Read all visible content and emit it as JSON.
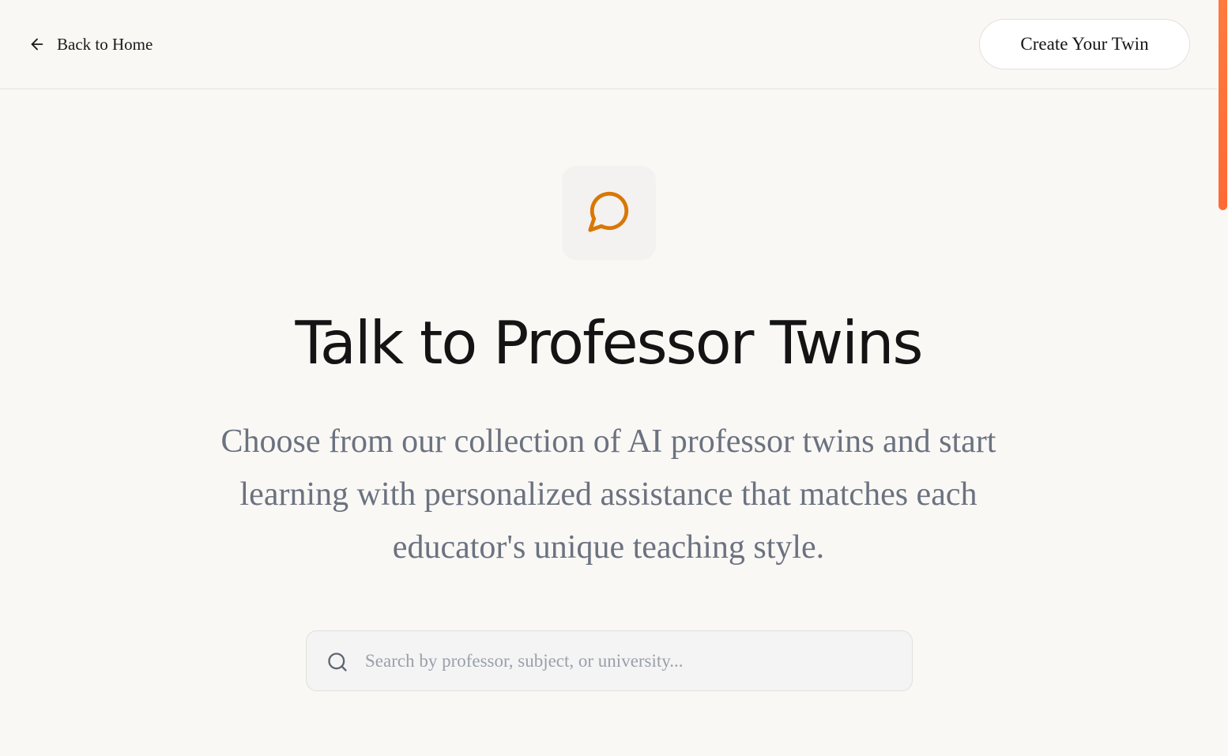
{
  "header": {
    "back_label": "Back to Home",
    "back_icon": "arrow-left-icon",
    "cta_label": "Create Your Twin"
  },
  "hero": {
    "icon": "message-circle-icon",
    "title": "Talk to Professor Twins",
    "subtitle": "Choose from our collection of AI professor twins and start learning with personalized assistance that matches each educator's unique teaching style."
  },
  "search": {
    "icon": "search-icon",
    "value": "",
    "placeholder": "Search by professor, subject, or university..."
  },
  "colors": {
    "accent": "#d97706",
    "scrollbar_thumb": "#ff6a35",
    "background": "#faf8f5",
    "title_text": "#141414",
    "subtitle_text": "#6b7280"
  }
}
